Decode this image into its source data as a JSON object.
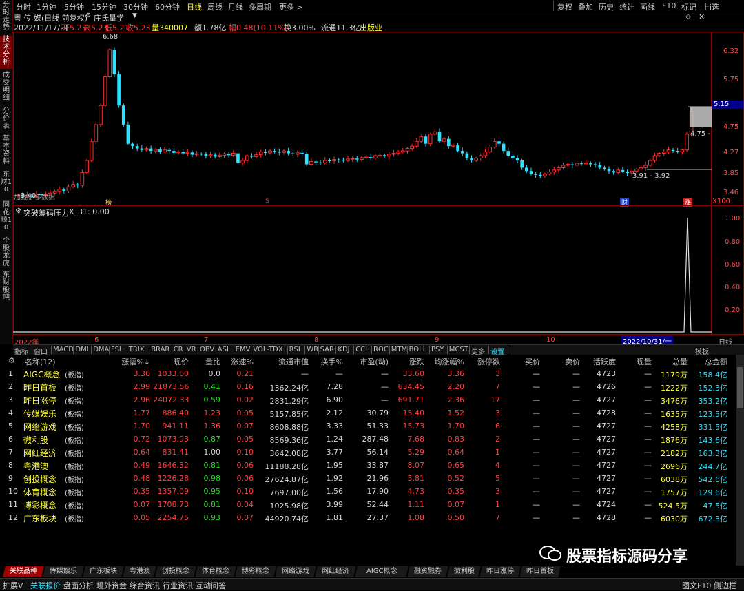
{
  "left_tabs": [
    "分时走势",
    "技术分析",
    "成交明细",
    "分价表",
    "基本资料",
    "东财10",
    "同花顺10",
    "个股龙虎",
    "东财股吧"
  ],
  "topbar": {
    "periods": [
      "分时",
      "1分钟",
      "5分钟",
      "15分钟",
      "30分钟",
      "60分钟",
      "日线",
      "周线",
      "月线",
      "多周期",
      "更多 >"
    ],
    "active_period": "日线",
    "right": [
      "复权",
      "叠加",
      "历史",
      "统计",
      "画线",
      "F10",
      "标记",
      "上i选"
    ]
  },
  "info": {
    "name": "粤 传 媒(日线 前复权)",
    "indicator_name": "庄氏量学",
    "date": "2022/11/17/四",
    "open": "开5.23",
    "high": "高5.23",
    "low": "低5.21",
    "close": "收5.23",
    "volume": "量340007",
    "amount": "额1.78亿",
    "amplitude": "幅0.48(10.11%)",
    "turnover": "换3.00%",
    "float_cap": "流通11.3亿",
    "tag": "出版业"
  },
  "main_chart": {
    "price_axis": [
      "6.32",
      "5.75",
      "5.15",
      "4.75",
      "4.27",
      "3.85",
      "3.46"
    ],
    "current_price": "5.15",
    "max_label": "6.68",
    "min_label": "3.40",
    "range_label": "3.91 - 3.92",
    "label_475": "4.75 -",
    "x100": "X100",
    "corner_text": "加载更多数据",
    "markers": [
      "榜",
      "$",
      "财",
      "涨"
    ]
  },
  "sub_chart": {
    "title": "突破筹码压力",
    "value": "X_31: 0.00",
    "axis": [
      "1.00",
      "0.80",
      "0.60",
      "0.40",
      "0.20"
    ],
    "x_labels": [
      "2022年",
      "6",
      "7",
      "8",
      "9",
      "10"
    ],
    "cursor_date": "2022/10/31/一",
    "right_label": "日线"
  },
  "indicator_bar": [
    "指标",
    "窗口",
    "MACD",
    "DMI",
    "DMA",
    "FSL",
    "TRIX",
    "BRAR",
    "CR",
    "VR",
    "OBV",
    "ASI",
    "EMV",
    "VOL-TDX",
    "RSI",
    "WR",
    "SAR",
    "KDJ",
    "CCI",
    "ROC",
    "MTM",
    "BOLL",
    "PSY",
    "MCST",
    "更多",
    "设置"
  ],
  "indicator_bar_right": "模板",
  "table": {
    "headers": [
      "名称(12)",
      "涨幅%↓",
      "现价",
      "量比",
      "涨速%",
      "流通市值",
      "换手%",
      "市盈(动)",
      "涨跌",
      "均涨幅%",
      "涨停数",
      "买价",
      "卖价",
      "活跃度",
      "现量",
      "总量",
      "总金额"
    ],
    "rows": [
      {
        "idx": "1",
        "name": "AIGC概念",
        "tag": "(板指)",
        "chg": "3.36",
        "price": "1033.60",
        "vr": "0.0",
        "spd": "0.21",
        "cap": "—",
        "turn": "—",
        "pe": "—",
        "diff": "33.60",
        "avg": "3.36",
        "lim": "3",
        "buy": "—",
        "sell": "—",
        "act": "4723",
        "cur": "—",
        "vol": "1179万",
        "amt": "158.4亿",
        "vrc": "w",
        "spc": "r"
      },
      {
        "idx": "2",
        "name": "昨日首板",
        "tag": "(板指)",
        "chg": "2.99",
        "price": "21873.56",
        "vr": "0.41",
        "spd": "0.16",
        "cap": "1362.24亿",
        "turn": "7.28",
        "pe": "—",
        "diff": "634.45",
        "avg": "2.20",
        "lim": "7",
        "buy": "—",
        "sell": "—",
        "act": "4726",
        "cur": "—",
        "vol": "1222万",
        "amt": "152.3亿",
        "vrc": "g",
        "spc": "r"
      },
      {
        "idx": "3",
        "name": "昨日涨停",
        "tag": "(板指)",
        "chg": "2.96",
        "price": "24072.33",
        "vr": "0.59",
        "spd": "0.02",
        "cap": "2831.29亿",
        "turn": "6.90",
        "pe": "—",
        "diff": "691.71",
        "avg": "2.36",
        "lim": "17",
        "buy": "—",
        "sell": "—",
        "act": "4727",
        "cur": "—",
        "vol": "3476万",
        "amt": "353.2亿",
        "vrc": "g",
        "spc": "r"
      },
      {
        "idx": "4",
        "name": "传媒娱乐",
        "tag": "(板指)",
        "chg": "1.77",
        "price": "886.40",
        "vr": "1.23",
        "spd": "0.05",
        "cap": "5157.85亿",
        "turn": "2.12",
        "pe": "30.79",
        "diff": "15.40",
        "avg": "1.52",
        "lim": "3",
        "buy": "—",
        "sell": "—",
        "act": "4728",
        "cur": "—",
        "vol": "1635万",
        "amt": "123.5亿",
        "vrc": "r",
        "spc": "r"
      },
      {
        "idx": "5",
        "name": "网络游戏",
        "tag": "(板指)",
        "chg": "1.70",
        "price": "941.11",
        "vr": "1.36",
        "spd": "0.07",
        "cap": "8608.88亿",
        "turn": "3.33",
        "pe": "51.33",
        "diff": "15.73",
        "avg": "1.70",
        "lim": "6",
        "buy": "—",
        "sell": "—",
        "act": "4727",
        "cur": "—",
        "vol": "4258万",
        "amt": "331.5亿",
        "vrc": "r",
        "spc": "r"
      },
      {
        "idx": "6",
        "name": "微利股",
        "tag": "(板指)",
        "chg": "0.72",
        "price": "1073.93",
        "vr": "0.87",
        "spd": "0.05",
        "cap": "8569.36亿",
        "turn": "1.24",
        "pe": "287.48",
        "diff": "7.68",
        "avg": "0.83",
        "lim": "2",
        "buy": "—",
        "sell": "—",
        "act": "4727",
        "cur": "—",
        "vol": "1876万",
        "amt": "143.6亿",
        "vrc": "g",
        "spc": "r"
      },
      {
        "idx": "7",
        "name": "网红经济",
        "tag": "(板指)",
        "chg": "0.64",
        "price": "831.41",
        "vr": "1.00",
        "spd": "0.10",
        "cap": "3642.08亿",
        "turn": "3.77",
        "pe": "56.14",
        "diff": "5.29",
        "avg": "0.64",
        "lim": "1",
        "buy": "—",
        "sell": "—",
        "act": "4727",
        "cur": "—",
        "vol": "2182万",
        "amt": "163.3亿",
        "vrc": "w",
        "spc": "r"
      },
      {
        "idx": "8",
        "name": "粤港澳",
        "tag": "(板指)",
        "chg": "0.49",
        "price": "1646.32",
        "vr": "0.81",
        "spd": "0.06",
        "cap": "11188.28亿",
        "turn": "1.95",
        "pe": "33.87",
        "diff": "8.07",
        "avg": "0.65",
        "lim": "4",
        "buy": "—",
        "sell": "—",
        "act": "4727",
        "cur": "—",
        "vol": "2696万",
        "amt": "244.7亿",
        "vrc": "g",
        "spc": "r"
      },
      {
        "idx": "9",
        "name": "创投概念",
        "tag": "(板指)",
        "chg": "0.48",
        "price": "1226.28",
        "vr": "0.98",
        "spd": "0.06",
        "cap": "27624.87亿",
        "turn": "1.92",
        "pe": "21.96",
        "diff": "5.81",
        "avg": "0.52",
        "lim": "5",
        "buy": "—",
        "sell": "—",
        "act": "4727",
        "cur": "—",
        "vol": "6038万",
        "amt": "542.6亿",
        "vrc": "g",
        "spc": "r"
      },
      {
        "idx": "10",
        "name": "体育概念",
        "tag": "(板指)",
        "chg": "0.35",
        "price": "1357.09",
        "vr": "0.95",
        "spd": "0.10",
        "cap": "7697.00亿",
        "turn": "1.56",
        "pe": "17.90",
        "diff": "4.73",
        "avg": "0.35",
        "lim": "3",
        "buy": "—",
        "sell": "—",
        "act": "4727",
        "cur": "—",
        "vol": "1757万",
        "amt": "129.6亿",
        "vrc": "g",
        "spc": "r"
      },
      {
        "idx": "11",
        "name": "博彩概念",
        "tag": "(板指)",
        "chg": "0.07",
        "price": "1708.73",
        "vr": "0.81",
        "spd": "0.04",
        "cap": "1025.98亿",
        "turn": "3.99",
        "pe": "52.44",
        "diff": "1.11",
        "avg": "0.07",
        "lim": "1",
        "buy": "—",
        "sell": "—",
        "act": "4724",
        "cur": "—",
        "vol": "524.5万",
        "amt": "47.5亿",
        "vrc": "g",
        "spc": "r"
      },
      {
        "idx": "12",
        "name": "广东板块",
        "tag": "(板指)",
        "chg": "0.05",
        "price": "2254.75",
        "vr": "0.93",
        "spd": "0.07",
        "cap": "44920.74亿",
        "turn": "1.81",
        "pe": "27.37",
        "diff": "1.08",
        "avg": "0.50",
        "lim": "7",
        "buy": "—",
        "sell": "—",
        "act": "4728",
        "cur": "—",
        "vol": "6030万",
        "amt": "672.3亿",
        "vrc": "g",
        "spc": "r"
      }
    ]
  },
  "watermark": "股票指标源码分享",
  "bottom_tabs": [
    "关联品种",
    "传媒娱乐",
    "广东板块",
    "粤港澳",
    "创投概念",
    "体育概念",
    "博彩概念",
    "网络游戏",
    "网红经济",
    "AIGC概念",
    "融资融券",
    "微利股",
    "昨日涨停",
    "昨日首板"
  ],
  "status_bar": [
    "扩展V",
    "关联报价",
    "盘面分析",
    "境外资金",
    "综合资讯",
    "行业资讯",
    "互动问答"
  ],
  "status_right": [
    "图文F10",
    "侧边栏"
  ],
  "colors": {
    "up": "#ff4040",
    "down": "#20e0ff",
    "frame": "#8b0000",
    "active_tab": "#a00000"
  }
}
